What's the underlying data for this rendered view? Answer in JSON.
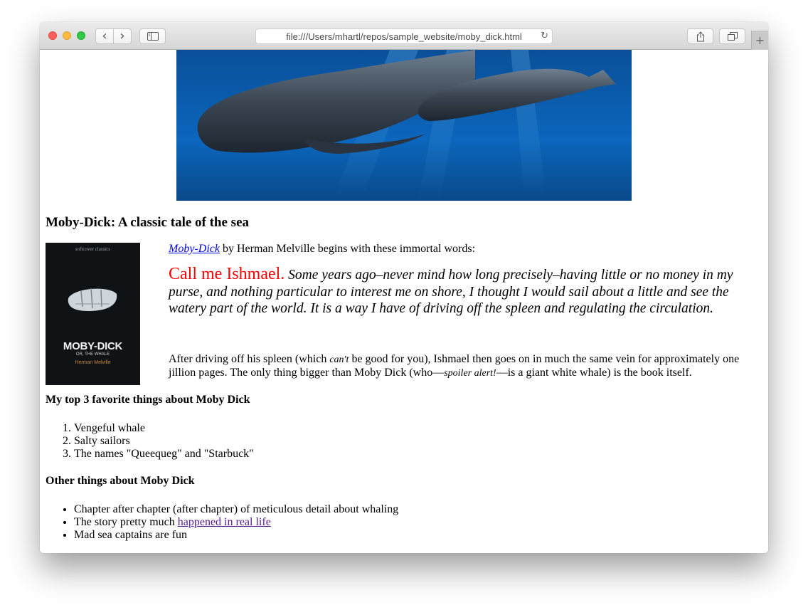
{
  "browser": {
    "url": "file:///Users/mhartl/repos/sample_website/moby_dick.html",
    "back_glyph": "‹",
    "forward_glyph": "›",
    "reload_glyph": "↻",
    "add_tab_glyph": "+",
    "icons": [
      "sidebar-icon",
      "share-icon",
      "tabs-overview-icon"
    ]
  },
  "page": {
    "heading": "Moby-Dick: A classic tale of the sea",
    "cover": {
      "series": "softcover classics",
      "title": "MOBY-DICK",
      "subtitle": "OR, THE WHALE",
      "author": "Herman Melville"
    },
    "intro": {
      "link_text": "Moby-Dick",
      "rest": " by Herman Melville begins with these immortal words:"
    },
    "quote": {
      "lead": "Call me Ishmael.",
      "rest": " Some years ago–never mind how long precisely–having little or no money in my purse, and nothing particular to interest me on shore, I thought I would sail about a little and see the watery part of the world. It is a way I have of driving off the spleen and regulating the circulation."
    },
    "after": {
      "p1": "After driving off his spleen (which ",
      "em1": "can't",
      "p2": " be good for you), Ishmael then goes on in much the same vein for approximately one jillion pages. The only thing bigger than Moby Dick (who—",
      "em2": "spoiler alert!",
      "p3": "—is a giant white whale) is the book itself."
    },
    "favorites": {
      "heading": "My top 3 favorite things about Moby Dick",
      "items": [
        "Vengeful whale",
        "Salty sailors",
        "The names \"Queequeg\" and \"Starbuck\""
      ]
    },
    "others": {
      "heading": "Other things about Moby Dick",
      "item1": "Chapter after chapter (after chapter) of meticulous detail about whaling",
      "item2_prefix": "The story pretty much ",
      "item2_link": "happened in real life",
      "item3": "Mad sea captains are fun"
    }
  },
  "colors": {
    "link": "#0000ee",
    "visited_link": "#551a8b",
    "quote_lead": "#ff0000",
    "hero_water": "#0b64b9"
  }
}
